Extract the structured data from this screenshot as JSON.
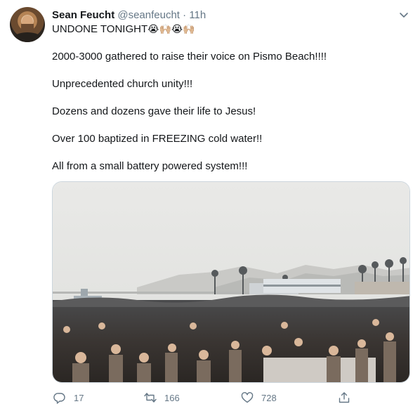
{
  "tweet": {
    "author_name": "Sean Feucht",
    "handle": "@seanfeucht",
    "separator": "·",
    "time": "11h",
    "line1_text": "UNDONE TONIGHT",
    "line1_emoji": "😭🙌🏼😭🙌🏼",
    "paragraphs": [
      "2000-3000 gathered to raise their voice on Pismo Beach!!!!",
      "Unprecedented church unity!!!",
      "Dozens and dozens gave their life to Jesus!",
      "Over 100 baptized in FREEZING cold water!!",
      "All from a small battery powered system!!!"
    ]
  },
  "actions": {
    "reply_count": "17",
    "retweet_count": "166",
    "like_count": "728"
  },
  "icons": {
    "more": "chevron-down-icon",
    "reply": "reply-icon",
    "retweet": "retweet-icon",
    "like": "heart-icon",
    "share": "share-icon"
  },
  "colors": {
    "text": "#14171a",
    "secondary": "#657786",
    "border": "#ccd6dd"
  }
}
